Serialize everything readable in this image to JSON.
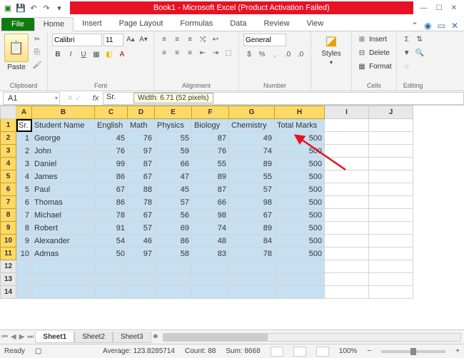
{
  "window": {
    "title": "Book1  -  Microsoft Excel (Product Activation Failed)"
  },
  "tabs": {
    "file": "File",
    "list": [
      "Home",
      "Insert",
      "Page Layout",
      "Formulas",
      "Data",
      "Review",
      "View"
    ],
    "active": 0
  },
  "ribbon": {
    "font_name": "Calibri",
    "font_size": "11",
    "number_format": "General",
    "groups": [
      "Clipboard",
      "Font",
      "Alignment",
      "Number",
      "Styles",
      "Cells",
      "Editing"
    ],
    "cells_cmds": [
      "Insert",
      "Delete",
      "Format"
    ]
  },
  "namebox": "A1",
  "formula": "Sr.",
  "tooltip": "Width: 6.71 (52 pixels)",
  "columns": [
    "A",
    "B",
    "C",
    "D",
    "E",
    "F",
    "G",
    "H",
    "I",
    "J"
  ],
  "rows": 14,
  "headers": [
    "Sr.",
    "Student Name",
    "English",
    "Math",
    "Physics",
    "Biology",
    "Chemistry",
    "Total Marks"
  ],
  "data": [
    [
      1,
      "George",
      45,
      76,
      55,
      87,
      49,
      500
    ],
    [
      2,
      "John",
      76,
      97,
      59,
      76,
      74,
      500
    ],
    [
      3,
      "Daniel",
      99,
      87,
      66,
      55,
      89,
      500
    ],
    [
      4,
      "James",
      86,
      67,
      47,
      89,
      55,
      500
    ],
    [
      5,
      "Paul",
      67,
      88,
      45,
      87,
      57,
      500
    ],
    [
      6,
      "Thomas",
      86,
      78,
      57,
      66,
      98,
      500
    ],
    [
      7,
      "Michael",
      78,
      67,
      56,
      98,
      67,
      500
    ],
    [
      8,
      "Robert",
      91,
      57,
      69,
      74,
      89,
      500
    ],
    [
      9,
      "Alexander",
      54,
      46,
      86,
      48,
      84,
      500
    ],
    [
      10,
      "Admas",
      50,
      97,
      58,
      83,
      78,
      500
    ]
  ],
  "sheets": [
    "Sheet1",
    "Sheet2",
    "Sheet3"
  ],
  "status": {
    "mode": "Ready",
    "average": "Average: 123.8285714",
    "count": "Count: 88",
    "sum": "Sum: 8668",
    "zoom": "100%"
  }
}
